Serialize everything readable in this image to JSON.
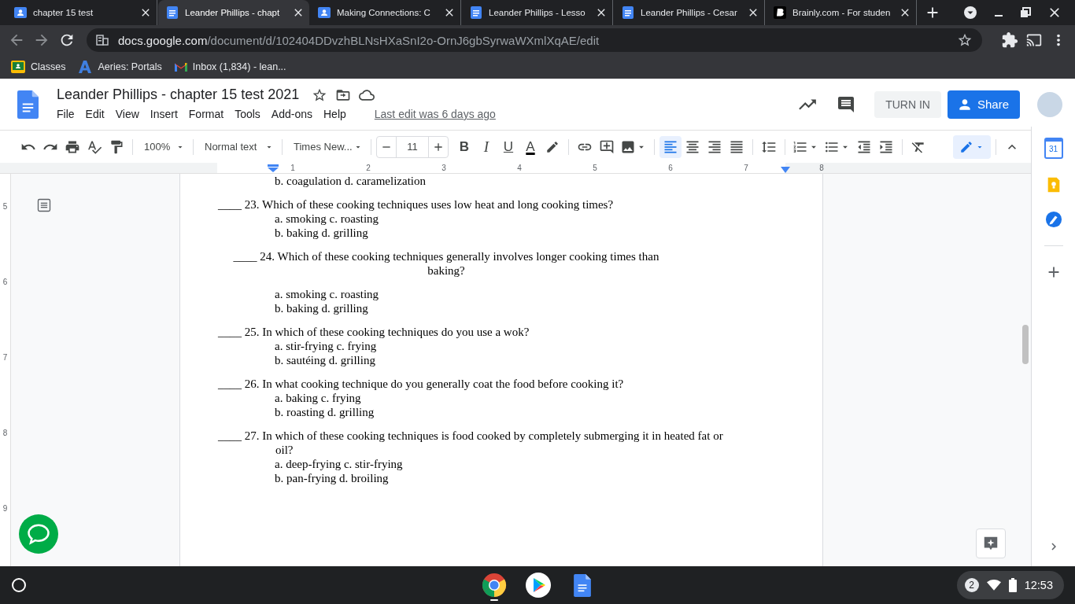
{
  "browser": {
    "tabs": [
      {
        "title": "chapter 15 test",
        "kind": "classroom",
        "selected": false
      },
      {
        "title": "Leander Phillips - chapt",
        "kind": "docs",
        "selected": true
      },
      {
        "title": "Making Connections: C",
        "kind": "classroom",
        "selected": false
      },
      {
        "title": "Leander Phillips - Lesso",
        "kind": "docs",
        "selected": false
      },
      {
        "title": "Leander Phillips - Cesar",
        "kind": "docs",
        "selected": false
      },
      {
        "title": "Brainly.com - For studen",
        "kind": "brainly",
        "selected": false
      }
    ],
    "url_domain": "docs.google.com",
    "url_path": "/document/d/102404DDvzhBLNsHXaSnI2o-OrnJ6gbSyrwaWXmlXqAE/edit",
    "bookmarks": [
      {
        "label": "Classes",
        "kind": "classroom"
      },
      {
        "label": "Aeries: Portals",
        "kind": "aeries"
      },
      {
        "label": "Inbox (1,834) - lean...",
        "kind": "gmail"
      }
    ]
  },
  "docs": {
    "title": "Leander Phillips - chapter 15 test 2021",
    "menu": [
      "File",
      "Edit",
      "View",
      "Insert",
      "Format",
      "Tools",
      "Add-ons",
      "Help"
    ],
    "last_edit": "Last edit was 6 days ago",
    "turn_in": "TURN IN",
    "share": "Share"
  },
  "toolbar": {
    "zoom": "100%",
    "style": "Normal text",
    "font": "Times New...",
    "font_size": "11",
    "format_buttons": [
      "B",
      "I",
      "U",
      "A"
    ],
    "align": [
      {
        "selected": true
      },
      {
        "selected": false
      },
      {
        "selected": false
      },
      {
        "selected": false
      }
    ]
  },
  "ruler": {
    "marks": [
      "1",
      "2",
      "3",
      "4",
      "5",
      "6",
      "7",
      "8"
    ],
    "vertical_marks": [
      "5",
      "6",
      "7",
      "8",
      "9"
    ]
  },
  "document": {
    "top_line": "b. coagulation d. caramelization",
    "questions": [
      {
        "blank": "____",
        "text": "23. Which of these cooking techniques uses low heat and long cooking times?",
        "centered": false,
        "options": [
          "a. smoking c. roasting",
          "b. baking d. grilling"
        ]
      },
      {
        "blank": "____",
        "text": "24. Which of these cooking techniques generally involves longer cooking times than baking?",
        "centered": true,
        "options": [
          "a. smoking c. roasting",
          "b. baking d. grilling"
        ]
      },
      {
        "blank": "____",
        "text": "25. In which of these cooking techniques do you use a wok?",
        "centered": false,
        "options": [
          "a. stir-frying c. frying",
          "b. sautéing d. grilling"
        ]
      },
      {
        "blank": "____",
        "text": "26. In what cooking technique do you generally coat the food before cooking it?",
        "centered": false,
        "options": [
          "a. baking c. frying",
          "b. roasting d. grilling"
        ]
      },
      {
        "blank": "____",
        "text": "27. In which of these cooking techniques is food cooked by completely submerging it in heated fat or oil?",
        "centered": false,
        "options": [
          "a. deep-frying c. stir-frying",
          "b. pan-frying d. broiling"
        ]
      }
    ]
  },
  "side_panel": {
    "calendar_day": "31"
  },
  "shelf": {
    "notifications": "2",
    "time": "12:53"
  }
}
